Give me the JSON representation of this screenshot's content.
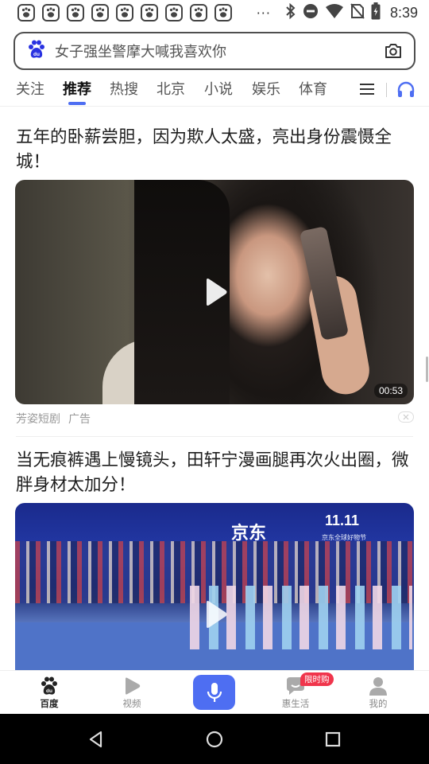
{
  "status_bar": {
    "notification_icons": [
      "baidu-paw-icon",
      "baidu-paw-icon",
      "baidu-paw-icon",
      "baidu-paw-icon",
      "baidu-paw-icon",
      "baidu-paw-icon",
      "baidu-paw-icon",
      "baidu-paw-icon",
      "baidu-paw-icon"
    ],
    "more": "···",
    "time": "8:39"
  },
  "search": {
    "placeholder": "女子强坐警摩大喊我喜欢你"
  },
  "tabs": [
    {
      "label": "关注",
      "active": false
    },
    {
      "label": "推荐",
      "active": true
    },
    {
      "label": "热搜",
      "active": false
    },
    {
      "label": "北京",
      "active": false
    },
    {
      "label": "小说",
      "active": false
    },
    {
      "label": "娱乐",
      "active": false
    },
    {
      "label": "体育",
      "active": false
    }
  ],
  "feed": {
    "items": [
      {
        "title": "五年的卧薪尝胆，因为欺人太盛，亮出身份震慑全城！",
        "duration": "00:53",
        "source": "芳姿短剧",
        "tag": "广告"
      },
      {
        "title": "当无痕裤遇上慢镜头，田轩宁漫画腿再次火出圈，微胖身材太加分！",
        "logo_text": "京东",
        "promo_text": "11.11",
        "promo_sub": "京东全球好物节"
      }
    ]
  },
  "bottom_nav": {
    "items": [
      {
        "label": "百度",
        "active": true
      },
      {
        "label": "视频",
        "active": false
      },
      {
        "label": "惠生活",
        "active": false,
        "badge": "限时购"
      },
      {
        "label": "我的",
        "active": false
      }
    ]
  },
  "colors": {
    "accent": "#4e6ef2",
    "badge": "#f0354c"
  }
}
